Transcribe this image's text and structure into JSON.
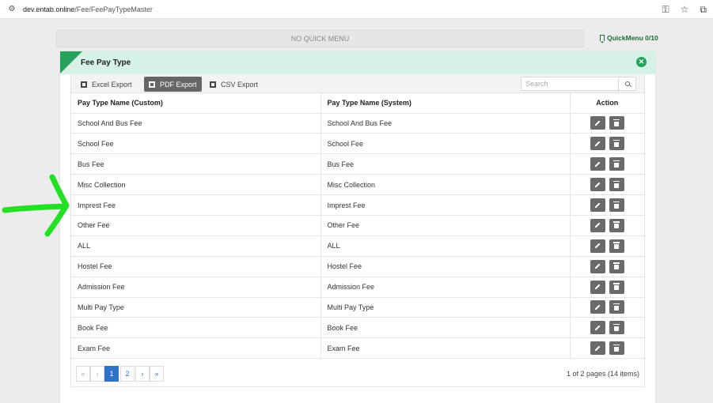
{
  "browser": {
    "url_host": "dev.entab.online",
    "url_path": "/Fee/FeePayTypeMaster"
  },
  "quick_menu": {
    "empty_text": "NO QUICK MENU",
    "link_label": "QuickMenu 0/10"
  },
  "panel": {
    "title": "Fee Pay Type",
    "accent_color": "#27a25d",
    "header_bg": "#d6f1e5"
  },
  "toolbar": {
    "excel_label": "Excel Export",
    "pdf_label": "PDF Export",
    "csv_label": "CSV Export",
    "search_placeholder": "Search"
  },
  "table": {
    "headers": [
      "Pay Type Name (Custom)",
      "Pay Type Name (System)",
      "Action"
    ],
    "rows": [
      [
        "School And Bus Fee",
        "School And Bus Fee"
      ],
      [
        "School Fee",
        "School Fee"
      ],
      [
        "Bus Fee",
        "Bus Fee"
      ],
      [
        "Misc Collection",
        "Misc Collection"
      ],
      [
        "Imprest Fee",
        "Imprest Fee"
      ],
      [
        "Other Fee",
        "Other Fee"
      ],
      [
        "ALL",
        "ALL"
      ],
      [
        "Hostel Fee",
        "Hostel Fee"
      ],
      [
        "Admission Fee",
        "Admission Fee"
      ],
      [
        "Multi Pay Type",
        "Multi Pay Type"
      ],
      [
        "Book Fee",
        "Book Fee"
      ],
      [
        "Exam Fee",
        "Exam Fee"
      ]
    ]
  },
  "pager": {
    "first": "«",
    "prev": "‹",
    "pages": [
      "1",
      "2"
    ],
    "next": "›",
    "last": "»",
    "info": "1 of 2 pages (14 items)"
  },
  "annotation": {
    "color": "#22e022",
    "icon": "arrow-right-icon"
  }
}
